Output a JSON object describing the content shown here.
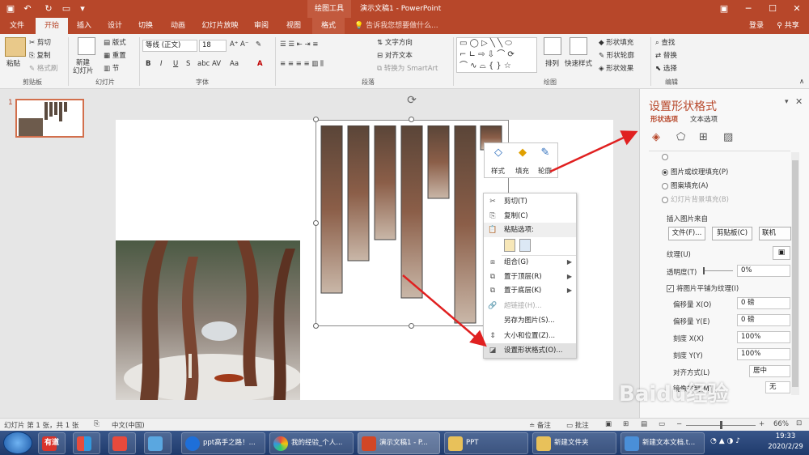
{
  "titlebar": {
    "contextual_tab": "绘图工具",
    "doc_title": "演示文稿1 - PowerPoint"
  },
  "tabs": [
    "文件",
    "开始",
    "插入",
    "设计",
    "切换",
    "动画",
    "幻灯片放映",
    "审阅",
    "视图",
    "格式"
  ],
  "tell_me": "告诉我您想要做什么...",
  "account": {
    "login": "登录",
    "share": "共享"
  },
  "ribbon": {
    "clipboard": {
      "paste": "粘贴",
      "cut": "剪切",
      "copy": "复制",
      "format_painter": "格式刷",
      "label": "剪贴板"
    },
    "slides": {
      "new_slide": "新建",
      "new_slide2": "幻灯片",
      "layout": "版式",
      "reset": "重置",
      "section": "节",
      "label": "幻灯片"
    },
    "font": {
      "name": "等线 (正文)",
      "size": "18",
      "label": "字体"
    },
    "paragraph": {
      "text_direction": "文字方向",
      "align_text": "对齐文本",
      "smartart": "转换为 SmartArt",
      "label": "段落"
    },
    "drawing": {
      "arrange": "排列",
      "quick_styles": "快速样式",
      "shape_fill": "形状填充",
      "shape_outline": "形状轮廓",
      "shape_effects": "形状效果",
      "label": "绘图"
    },
    "editing": {
      "find": "查找",
      "replace": "替换",
      "select": "选择",
      "label": "编辑"
    }
  },
  "slide_number": "1",
  "mini_toolbar": {
    "style": "样式",
    "fill": "填充",
    "outline": "轮廓"
  },
  "context_menu": [
    {
      "label": "剪切(T)",
      "icon": "scissors",
      "disabled": false,
      "arrow": false
    },
    {
      "label": "复制(C)",
      "icon": "copy",
      "disabled": false,
      "arrow": false
    },
    {
      "label": "粘贴选项:",
      "icon": "paste",
      "disabled": false,
      "arrow": false
    },
    {
      "label": "",
      "icon": "paste-options",
      "disabled": false,
      "arrow": false
    },
    {
      "label": "组合(G)",
      "icon": "group",
      "disabled": false,
      "arrow": true
    },
    {
      "label": "置于顶层(R)",
      "icon": "bring-front",
      "disabled": false,
      "arrow": true
    },
    {
      "label": "置于底层(K)",
      "icon": "send-back",
      "disabled": false,
      "arrow": true
    },
    {
      "label": "超链接(H)...",
      "icon": "link",
      "disabled": true,
      "arrow": false
    },
    {
      "label": "另存为图片(S)...",
      "icon": "",
      "disabled": false,
      "arrow": false
    },
    {
      "label": "大小和位置(Z)...",
      "icon": "size",
      "disabled": false,
      "arrow": false
    },
    {
      "label": "设置形状格式(O)...",
      "icon": "format",
      "disabled": false,
      "arrow": false
    }
  ],
  "format_pane": {
    "title": "设置形状格式",
    "tab_shape": "形状选项",
    "tab_text": "文本选项",
    "radio_picture": "图片或纹理填充(P)",
    "radio_pattern": "图案填充(A)",
    "radio_bg": "幻灯片背景填充(B)",
    "insert_from": "插入图片来自",
    "btn_file": "文件(F)...",
    "btn_clip": "剪贴板(C)",
    "btn_online": "联机(E)...",
    "texture": "纹理(U)",
    "transparency": "透明度(T)",
    "transparency_val": "0%",
    "tile": "将图片平铺为纹理(I)",
    "offset_x": "偏移量 X(O)",
    "offset_x_val": "0 磅",
    "offset_y": "偏移量 Y(E)",
    "offset_y_val": "0 磅",
    "scale_x": "刻度 X(X)",
    "scale_x_val": "100%",
    "scale_y": "刻度 Y(Y)",
    "scale_y_val": "100%",
    "alignment": "对齐方式(L)",
    "alignment_val": "居中",
    "mirror": "镜像类型(M)",
    "mirror_val": "无"
  },
  "statusbar": {
    "slide_info": "幻灯片 第 1 张，共 1 张",
    "language": "中文(中国)",
    "notes": "备注",
    "comments": "批注",
    "zoom": "66%"
  },
  "taskbar": {
    "items": [
      {
        "label": "有道",
        "color": "#d9342b"
      },
      {
        "label": "",
        "color": "#7ab648"
      },
      {
        "label": "",
        "color": "#e84a3c"
      },
      {
        "label": "",
        "color": "#5aa7e0"
      },
      {
        "label": "ppt高手之路！...",
        "color": "#1e6fd9"
      },
      {
        "label": "我的经验_个人...",
        "color": "#f0a030"
      },
      {
        "label": "演示文稿1 - P...",
        "color": "#d24726"
      },
      {
        "label": "PPT",
        "color": "#e8c15a"
      },
      {
        "label": "新建文件夹",
        "color": "#e8c15a"
      },
      {
        "label": "新建文本文档.t...",
        "color": "#4a8fd8"
      }
    ],
    "time": "19:33",
    "date": "2020/2/29"
  },
  "watermark": "Baidu经验",
  "colors": {
    "accent": "#b7472a",
    "pane_title": "#d04a25",
    "arrow": "#e02020"
  }
}
